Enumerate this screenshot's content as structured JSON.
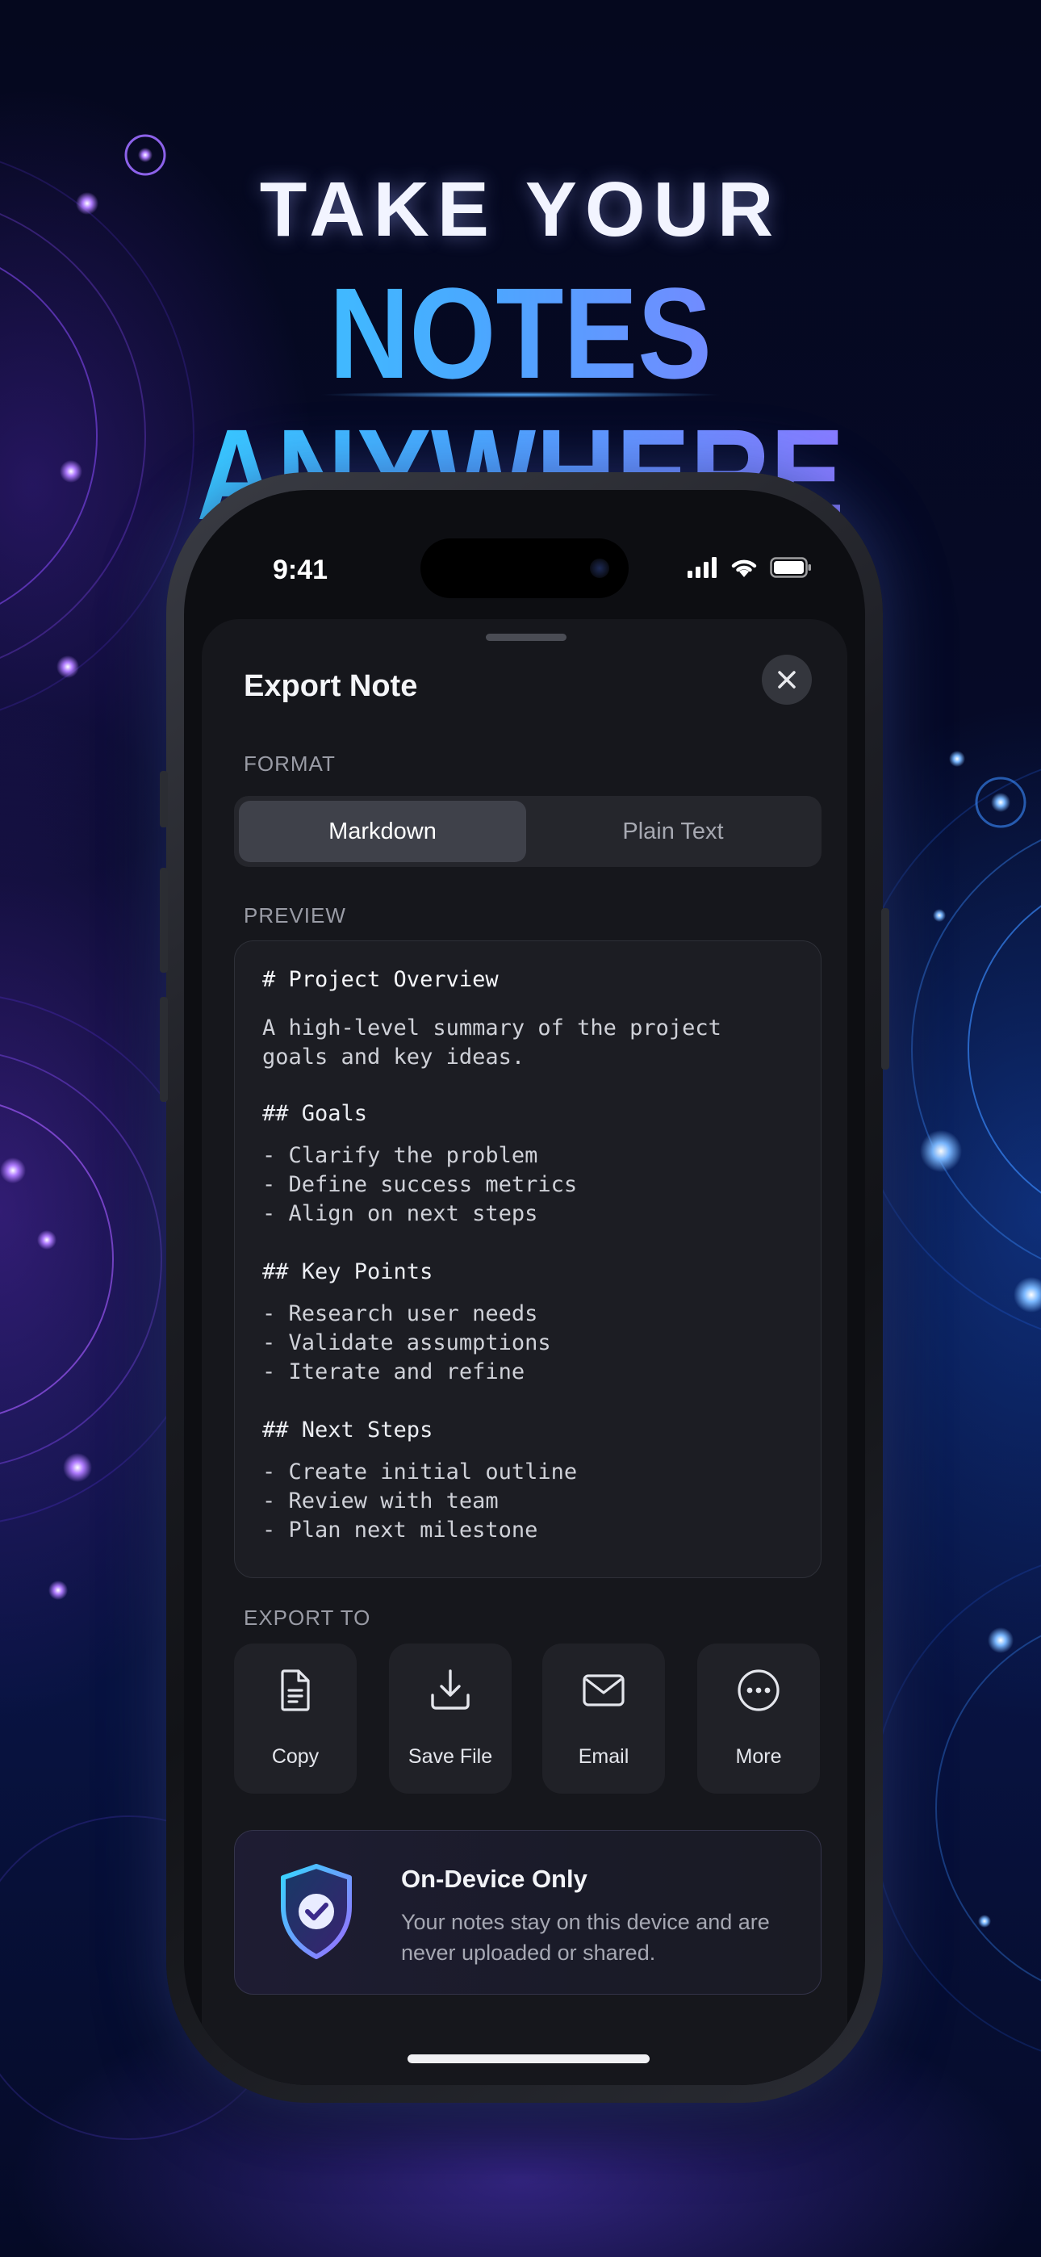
{
  "promo": {
    "headline_line1": "TAKE YOUR",
    "headline_line2": "NOTES ANYWHERE"
  },
  "status_bar": {
    "time": "9:41"
  },
  "sheet": {
    "title": "Export Note",
    "format_label": "FORMAT",
    "formats": [
      "Markdown",
      "Plain Text"
    ],
    "selected_format": "Markdown",
    "preview_label": "PREVIEW",
    "preview": {
      "h1": "# Project Overview",
      "summary_1": "A high-level summary of the project",
      "summary_2": "goals and key ideas.",
      "goals_heading": "## Goals",
      "goals": [
        "- Clarify the problem",
        "- Define success metrics",
        "- Align on next steps"
      ],
      "key_points_heading": "## Key Points",
      "key_points": [
        "- Research user needs",
        "- Validate assumptions",
        "- Iterate and refine"
      ],
      "next_steps_heading": "## Next Steps",
      "next_steps": [
        "- Create initial outline",
        "- Review with team",
        "- Plan next milestone"
      ]
    },
    "export_label": "EXPORT TO",
    "export_options": [
      {
        "label": "Copy",
        "icon": "document-icon"
      },
      {
        "label": "Save File",
        "icon": "download-icon"
      },
      {
        "label": "Email",
        "icon": "envelope-icon"
      },
      {
        "label": "More",
        "icon": "ellipsis-circle-icon"
      }
    ],
    "privacy": {
      "title": "On-Device Only",
      "body": "Your notes stay on this device and are never uploaded or shared."
    }
  },
  "colors": {
    "accent_cyan": "#2fd9ff",
    "accent_violet": "#9d6bff",
    "sheet_bg": "#16171c"
  }
}
